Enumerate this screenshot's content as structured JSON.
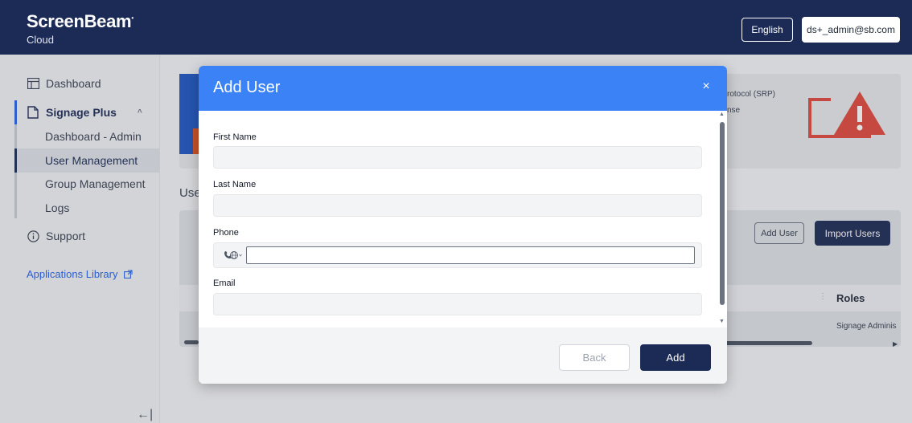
{
  "header": {
    "brand": "ScreenBeam",
    "brand_mark": "•",
    "brand_sub": "Cloud",
    "language": "English",
    "user_email": "ds+_admin@sb.com"
  },
  "sidebar": {
    "items": [
      {
        "label": "Dashboard",
        "icon": "dashboard-icon"
      },
      {
        "label": "Signage Plus",
        "icon": "file-icon",
        "expanded": true
      },
      {
        "label": "Support",
        "icon": "info-icon"
      }
    ],
    "subitems": [
      "Dashboard - Admin",
      "User Management",
      "Group Management",
      "Logs"
    ],
    "active_subitem": "User Management",
    "applications_library": "Applications Library",
    "collapse_icon": "collapse-left-icon"
  },
  "background": {
    "srp_text": "rotocol (SRP)",
    "nse_text": "nse",
    "section_title": "Use",
    "add_user_label": "Add User",
    "import_users_label": "Import Users",
    "roles_header": "Roles",
    "role_value": "Signage Adminis"
  },
  "modal": {
    "title": "Add User",
    "close_icon": "close-icon",
    "fields": {
      "first_name_label": "First Name",
      "first_name_value": "",
      "last_name_label": "Last Name",
      "last_name_value": "",
      "phone_label": "Phone",
      "phone_value": "",
      "phone_country_icon": "globe-phone-icon",
      "email_label": "Email",
      "email_value": ""
    },
    "back_label": "Back",
    "add_label": "Add"
  },
  "colors": {
    "header_bg": "#1c2b55",
    "modal_header": "#3b82f6",
    "primary_button": "#1c2b55",
    "warning": "#e0483b",
    "link": "#2563eb"
  }
}
